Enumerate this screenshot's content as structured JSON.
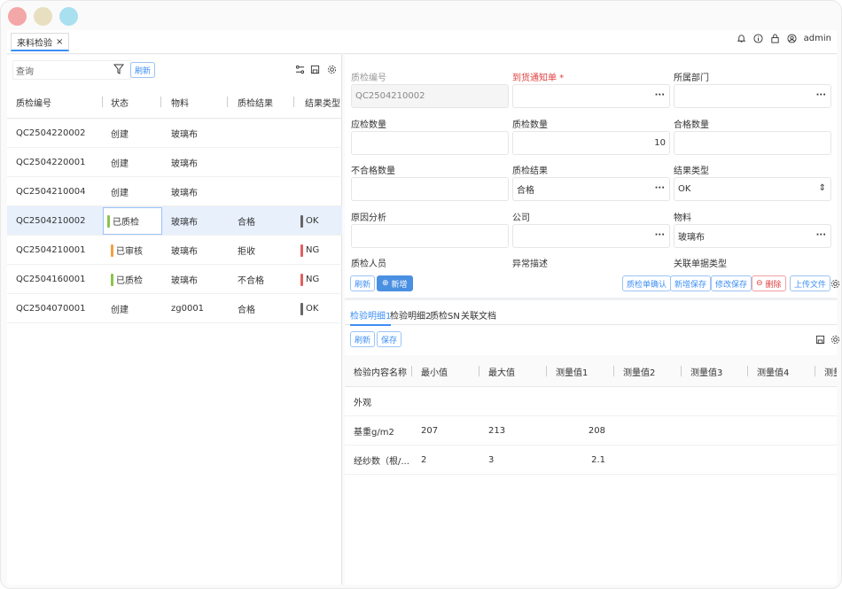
{
  "colors": {
    "accent": "#3d8ef5",
    "ok": "#666666",
    "ng": "#e06060",
    "status_green": "#8bc34a",
    "status_orange": "#f0a040",
    "required": "#e04040"
  },
  "window": {
    "tab_label": "来料检验",
    "tab_close": "×",
    "user": "admin"
  },
  "list": {
    "search_placeholder": "查询",
    "refresh_label": "刷新",
    "columns": [
      "质检编号",
      "状态",
      "物料",
      "质检结果",
      "结果类型"
    ],
    "rows": [
      {
        "code": "QC2504220002",
        "status": "创建",
        "status_bar": "",
        "material": "玻璃布",
        "result": "",
        "type": "",
        "type_bar": ""
      },
      {
        "code": "QC2504220001",
        "status": "创建",
        "status_bar": "",
        "material": "玻璃布",
        "result": "",
        "type": "",
        "type_bar": ""
      },
      {
        "code": "QC2504210004",
        "status": "创建",
        "status_bar": "",
        "material": "玻璃布",
        "result": "",
        "type": "",
        "type_bar": ""
      },
      {
        "code": "QC2504210002",
        "status": "已质检",
        "status_bar": "green",
        "material": "玻璃布",
        "result": "合格",
        "type": "OK",
        "type_bar": "ok",
        "selected": true
      },
      {
        "code": "QC2504210001",
        "status": "已审核",
        "status_bar": "orange",
        "material": "玻璃布",
        "result": "拒收",
        "type": "NG",
        "type_bar": "ng"
      },
      {
        "code": "QC2504160001",
        "status": "已质检",
        "status_bar": "green",
        "material": "玻璃布",
        "result": "不合格",
        "type": "NG",
        "type_bar": "ng"
      },
      {
        "code": "QC2504070001",
        "status": "创建",
        "status_bar": "",
        "material": "zg0001",
        "result": "合格",
        "type": "OK",
        "type_bar": "ok"
      }
    ]
  },
  "form": {
    "qc_no_label": "质检编号",
    "qc_no_value": "QC2504210002",
    "arrival_label": "到货通知单 *",
    "dept_label": "所属部门",
    "due_qty_label": "应检数量",
    "qc_qty_label": "质检数量",
    "qc_qty_value": "10",
    "pass_qty_label": "合格数量",
    "fail_qty_label": "不合格数量",
    "qc_result_label": "质检结果",
    "qc_result_value": "合格",
    "result_type_label": "结果类型",
    "result_type_value": "OK",
    "cause_label": "原因分析",
    "company_label": "公司",
    "material_label": "物料",
    "material_value": "玻璃布",
    "inspector_label": "质检人员",
    "abnormal_label": "异常描述",
    "related_type_label": "关联单据类型",
    "lookup_glyph": "···",
    "select_glyph": "⇕"
  },
  "form_toolbar": {
    "refresh": "刷新",
    "add": "新增",
    "confirm": "质检单确认",
    "save_new": "新增保存",
    "save_edit": "修改保存",
    "delete": "删除",
    "upload": "上传文件"
  },
  "detail": {
    "tabs": [
      "检验明细1",
      "检验明细2",
      "质检SN",
      "关联文档"
    ],
    "refresh": "刷新",
    "save": "保存",
    "columns": [
      "检验内容名称",
      "最小值",
      "最大值",
      "测量值1",
      "测量值2",
      "测量值3",
      "测量值4",
      "测量"
    ],
    "rows": [
      {
        "name": "外观",
        "min": "",
        "max": "",
        "m1": ""
      },
      {
        "name": "基重g/m2",
        "min": "207",
        "max": "213",
        "m1": "208"
      },
      {
        "name": "经纱数（根/...",
        "min": "2",
        "max": "3",
        "m1": "2.1"
      }
    ]
  }
}
